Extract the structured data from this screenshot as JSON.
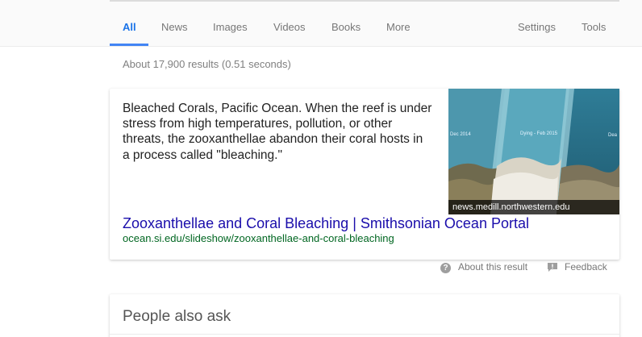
{
  "nav": {
    "tabs": [
      {
        "label": "All",
        "active": true
      },
      {
        "label": "News"
      },
      {
        "label": "Images"
      },
      {
        "label": "Videos"
      },
      {
        "label": "Books"
      },
      {
        "label": "More"
      }
    ],
    "settings_label": "Settings",
    "tools_label": "Tools"
  },
  "result_stats": "About 17,900 results (0.51 seconds)",
  "featured_snippet": {
    "text": "Bleached Corals, Pacific Ocean. When the reef is under stress from high temperatures, pollution, or other threats, the zooxanthellae abandon their coral hosts in a process called \"bleaching.\"",
    "image": {
      "source": "news.medill.northwestern.edu",
      "labels": [
        "Dec 2014",
        "Dying - Feb 2015",
        "Dea"
      ]
    },
    "title": "Zooxanthellae and Coral Bleaching | Smithsonian Ocean Portal",
    "url": "ocean.si.edu/slideshow/zooxanthellae-and-coral-bleaching"
  },
  "footer": {
    "about_label": "About this result",
    "feedback_label": "Feedback",
    "help_icon_glyph": "?"
  },
  "people_also_ask": {
    "title": "People also ask"
  },
  "colors": {
    "link": "#1a0dab",
    "url": "#006621",
    "active_tab": "#1a73e8",
    "underline": "#4285f4"
  },
  "icons": {
    "help": "help-circle-icon",
    "feedback": "feedback-flag-icon"
  }
}
